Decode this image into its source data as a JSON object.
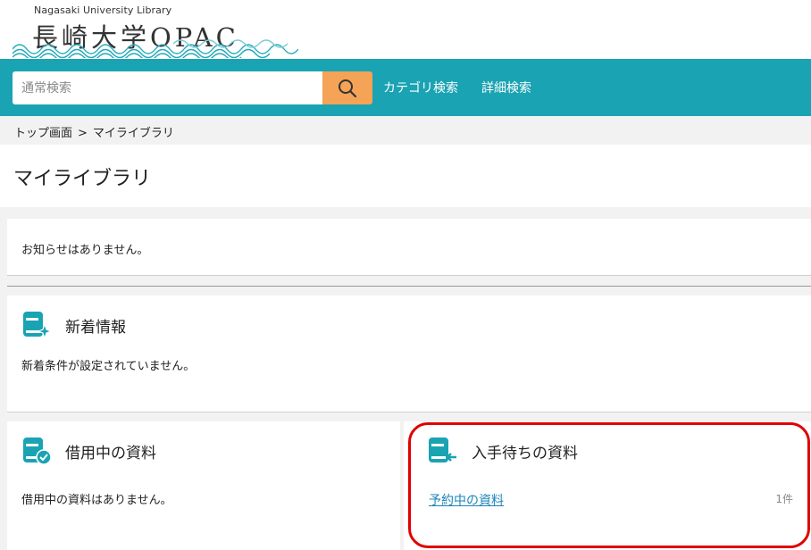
{
  "header": {
    "logo_sub": "Nagasaki University Library",
    "logo_main": "長崎大学OPAC"
  },
  "nav": {
    "search_placeholder": "通常検索",
    "search_value": "",
    "links": [
      "カテゴリ検索",
      "詳細検索"
    ]
  },
  "breadcrumb": {
    "home": "トップ画面",
    "separator": ">",
    "current": "マイライブラリ"
  },
  "page": {
    "title": "マイライブラリ"
  },
  "notice": {
    "text": "お知らせはありません。"
  },
  "new_items": {
    "title": "新着情報",
    "text": "新着条件が設定されていません。"
  },
  "loans": {
    "title": "借用中の資料",
    "text": "借用中の資料はありません。"
  },
  "holds": {
    "title": "入手待ちの資料",
    "link_label": "予約中の資料",
    "count": "1件"
  },
  "colors": {
    "nav_bg": "#1aa3b3",
    "search_button": "#f5a356",
    "icon_teal": "#1aa3b3",
    "link": "#1a84b8",
    "highlight": "#e00000"
  },
  "icons": {
    "search": "search-icon",
    "new_items": "book-sparkle-icon",
    "loans": "book-check-icon",
    "holds": "book-arrow-icon"
  }
}
